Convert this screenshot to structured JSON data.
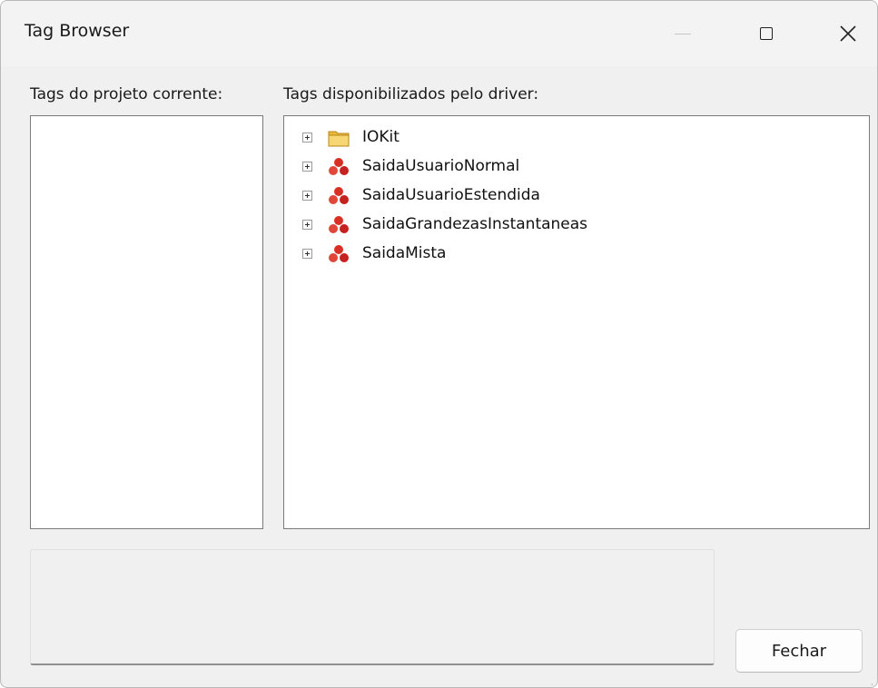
{
  "window": {
    "title": "Tag Browser"
  },
  "left_panel": {
    "label": "Tags do projeto corrente:"
  },
  "right_panel": {
    "label": "Tags disponibilizados pelo driver:",
    "tree": [
      {
        "label": "IOKit",
        "icon": "folder-icon"
      },
      {
        "label": "SaidaUsuarioNormal",
        "icon": "tag-group-icon"
      },
      {
        "label": "SaidaUsuarioEstendida",
        "icon": "tag-group-icon"
      },
      {
        "label": "SaidaGrandezasInstantaneas",
        "icon": "tag-group-icon"
      },
      {
        "label": "SaidaMista",
        "icon": "tag-group-icon"
      }
    ]
  },
  "buttons": {
    "close_label": "Fechar"
  },
  "colors": {
    "folder": "#f2c94c",
    "tag_group": "#d93025"
  }
}
